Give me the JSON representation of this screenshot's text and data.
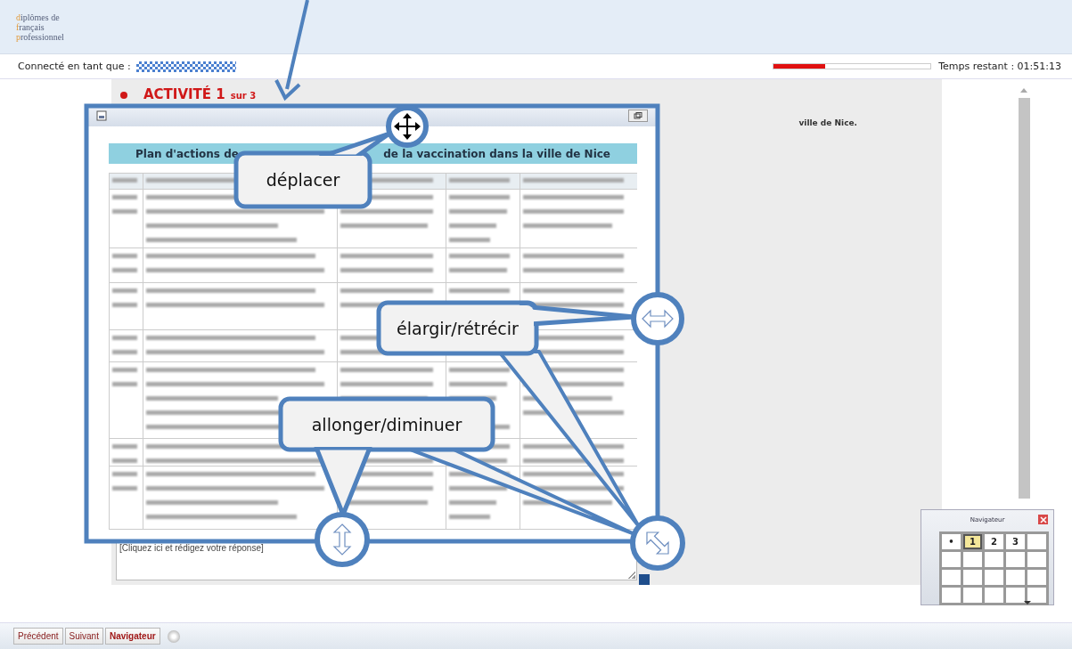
{
  "header": {
    "logo_lines": [
      "diplômes de",
      "français",
      "professionnel"
    ]
  },
  "user_bar": {
    "label": "Connecté en tant que :",
    "timer": {
      "level": 0.33
    },
    "time_remaining": "Temps restant : 01:51:13"
  },
  "activity": {
    "title": "ACTIVITÉ 1",
    "suffix": "sur 3",
    "instruction_tail": "ville de Nice."
  },
  "document_window": {
    "table_title_parts": [
      "Plan d'actions de",
      "de la vaccination dans la ville de Nice"
    ]
  },
  "answer": {
    "placeholder": "[Cliquez ici et rédigez votre réponse]"
  },
  "navigator": {
    "title": "Navigateur",
    "cells": [
      {
        "label": "•",
        "selected": false
      },
      {
        "label": "1",
        "selected": true
      },
      {
        "label": "2",
        "selected": false
      },
      {
        "label": "3",
        "selected": false
      }
    ]
  },
  "buttons": [
    {
      "label": "Précédent",
      "kind": "normal"
    },
    {
      "label": "Suivant",
      "kind": "normal"
    },
    {
      "label": "Navigateur",
      "kind": "primary"
    }
  ],
  "annotations": [
    {
      "kind": "move",
      "label": "déplacer"
    },
    {
      "kind": "width",
      "label": "élargir/rétrécir"
    },
    {
      "kind": "height",
      "label": "allonger/diminuer"
    }
  ]
}
